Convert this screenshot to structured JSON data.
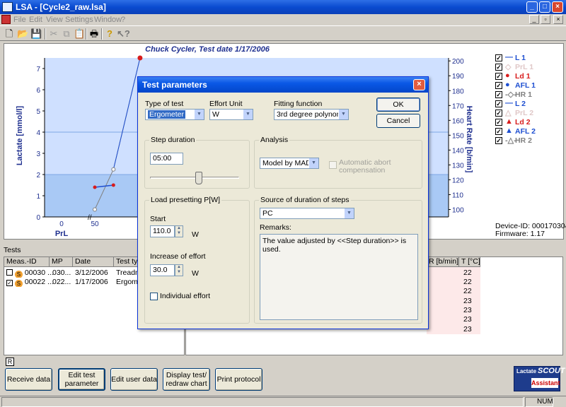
{
  "window": {
    "title": "LSA - [Cycle2_raw.lsa]",
    "min": "_",
    "max": "□",
    "close": "×"
  },
  "menu": {
    "items": [
      "File",
      "Edit",
      "View",
      "Settings",
      "Window",
      "?"
    ],
    "mdi": [
      "_",
      "▫",
      "×"
    ]
  },
  "toolbar": {
    "icons": [
      "new-icon",
      "open-icon",
      "save-icon",
      "cut-icon",
      "copy-icon",
      "paste-icon",
      "print-icon",
      "help-icon",
      "context-help-icon"
    ]
  },
  "chart": {
    "title": "Chuck Cycler, Test date 1/17/2006",
    "ylabel": "Lactate [mmol/l]",
    "y2label": "Heart Rate [b/min]",
    "xlabel_prl": "PrL",
    "x_tick_0": "0",
    "x_tick_50": "50",
    "device_id": "Device-ID: 0001703041",
    "firmware": "Firmware: 1.17"
  },
  "chart_data": {
    "type": "line",
    "title": "Chuck Cycler, Test date 1/17/2006",
    "ylabel": "Lactate [mmol/l]",
    "y2label": "Heart Rate [b/min]",
    "y_ticks": [
      "0",
      "1",
      "2",
      "3",
      "4",
      "5",
      "6",
      "7"
    ],
    "y2_ticks": [
      "100",
      "110",
      "120",
      "130",
      "140",
      "150",
      "160",
      "170",
      "180",
      "190",
      "200"
    ],
    "ylim": [
      0,
      7.5
    ],
    "y2lim": [
      95,
      202
    ],
    "series_ld1_points": [
      [
        50,
        1.4
      ],
      [
        78,
        1.5
      ]
    ],
    "series_hr1_points": [
      [
        50,
        100
      ],
      [
        78,
        127
      ],
      [
        118,
        202
      ]
    ],
    "colors": {
      "L1": "#1e4fd1",
      "Ld1": "#d81c1c",
      "HR": "#808080"
    }
  },
  "legend": [
    {
      "label": "L 1",
      "marker": "—",
      "color": "#1e4fd1"
    },
    {
      "label": "PrL 1",
      "marker": "◇",
      "color": "#e0c8c8"
    },
    {
      "label": "Ld 1",
      "marker": "●",
      "color": "#d81c1c"
    },
    {
      "label": "AFL 1",
      "marker": "●",
      "color": "#1e4fd1"
    },
    {
      "label": "HR 1",
      "marker": "-◇-",
      "color": "#808080"
    },
    {
      "label": "L 2",
      "marker": "—",
      "color": "#1e4fd1"
    },
    {
      "label": "PrL 2",
      "marker": "△",
      "color": "#e0c8c8"
    },
    {
      "label": "Ld 2",
      "marker": "▲",
      "color": "#d81c1c"
    },
    {
      "label": "AFL 2",
      "marker": "▲",
      "color": "#1e4fd1"
    },
    {
      "label": "HR 2",
      "marker": "-△-",
      "color": "#808080"
    }
  ],
  "tests": {
    "label": "Tests",
    "headers": [
      "Meas.-ID",
      "MP",
      "Date",
      "Test typ"
    ],
    "rows": [
      {
        "id": "00030 ...",
        "mp": "030...",
        "date": "3/12/2006",
        "type": "Treadmi"
      },
      {
        "id": "00022 ...",
        "mp": "022...",
        "date": "1/17/2006",
        "type": "Ergomet"
      }
    ],
    "right_headers": [
      "R [b/min]",
      "T [°C]"
    ],
    "temps": [
      "22",
      "22",
      "22",
      "23",
      "23",
      "23",
      "23"
    ],
    "partial_row": "(hidden row)",
    "r_box": "R"
  },
  "buttons": {
    "receive": "Receive data",
    "edit_test_l1": "Edit test",
    "edit_test_l2": "parameter",
    "edit_user": "Edit user data",
    "display_l1": "Display test/",
    "display_l2": "redraw chart",
    "print": "Print protocol"
  },
  "logo": {
    "line1": "Lactate",
    "brand": "SCOUT",
    "line2": "Assistant"
  },
  "status": {
    "num": "NUM"
  },
  "dialog": {
    "title": "Test parameters",
    "close": "×",
    "type_of_test_label": "Type of test",
    "type_of_test_value": "Ergometer",
    "effort_unit_label": "Effort Unit",
    "effort_unit_value": "W",
    "fitting_label": "Fitting function",
    "fitting_value": "3rd degree polynom",
    "ok": "OK",
    "cancel": "Cancel",
    "step_duration_group": "Step duration",
    "step_duration_value": "05:00",
    "step_slider_fraction": 0.55,
    "analysis_group": "Analysis",
    "analysis_value": "Model by MADER",
    "auto_abort_l1": "Automatic abort",
    "auto_abort_l2": "compensation",
    "load_group": "Load presetting P[W]",
    "start_label": "Start",
    "start_value": "110.0",
    "start_unit": "W",
    "increase_label": "Increase of effort",
    "increase_value": "30.0",
    "increase_unit": "W",
    "individual_label": "Individual effort",
    "source_group": "Source of duration of steps",
    "source_value": "PC",
    "remarks_label": "Remarks:",
    "remarks_text": "The value adjusted by <<Step duration>> is used."
  }
}
